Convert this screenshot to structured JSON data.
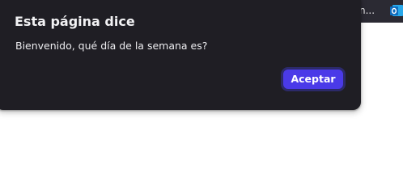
{
  "browser": {
    "toolbar_text": "n...",
    "toolbar_icon": "outlook-icon"
  },
  "dialog": {
    "title": "Esta página dice",
    "message": "Bienvenido, qué día de la semana es?",
    "accept_label": "Aceptar"
  },
  "colors": {
    "dialog_bg": "#1f1e24",
    "button_bg": "#4a3ae8",
    "toolbar_bg": "#2b2a33",
    "outlook_blue": "#0f6cbd"
  }
}
